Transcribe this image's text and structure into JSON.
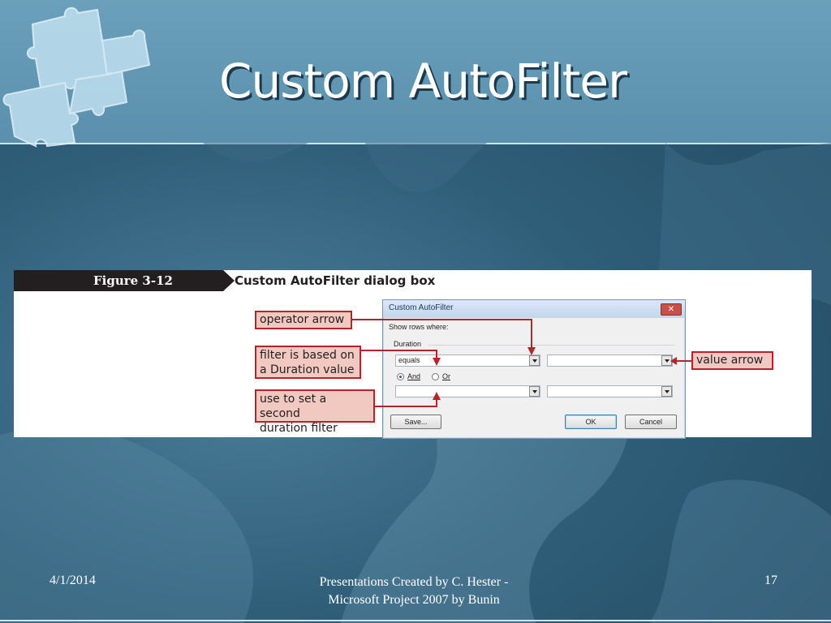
{
  "slide": {
    "title": "Custom AutoFilter"
  },
  "figure": {
    "number": "Figure  3-12",
    "caption": "Custom AutoFilter dialog box"
  },
  "callouts": {
    "operator_arrow": "operator arrow",
    "filter_based_line1": "filter is based on",
    "filter_based_line2": "a Duration value",
    "second_filter_line1": "use to set a second",
    "second_filter_line2": "duration filter",
    "value_arrow": "value arrow"
  },
  "dialog": {
    "title": "Custom AutoFilter",
    "close_label": "✕",
    "show_rows_label": "Show rows where:",
    "group_label": "Duration",
    "operator1_value": "equals",
    "value1": "",
    "and_label": "And",
    "or_label": "Or",
    "and_selected": true,
    "operator2_value": "",
    "value2": "",
    "save_label": "Save...",
    "ok_label": "OK",
    "cancel_label": "Cancel"
  },
  "footer": {
    "date": "4/1/2014",
    "credit_line1": "Presentations Created by C. Hester -",
    "credit_line2": "Microsoft Project 2007 by Bunin",
    "page_number": "17"
  },
  "colors": {
    "header": "#5a90ad",
    "background": "#2f5e79",
    "callout_fill": "#f1c9c1",
    "callout_border": "#b5242b"
  }
}
